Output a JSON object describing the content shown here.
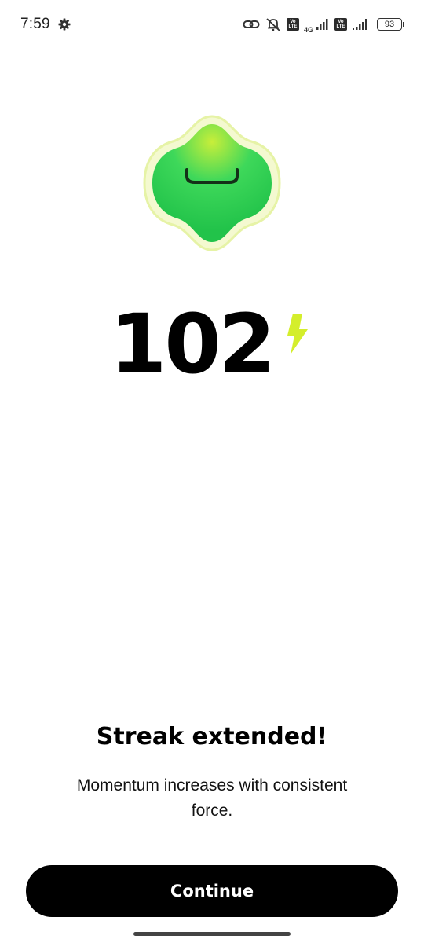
{
  "status_bar": {
    "time": "7:59",
    "network_label": "4G",
    "lte_badge_top": "Vo",
    "lte_badge_bottom": "LTE",
    "battery_level": "93",
    "icons": [
      "gear-icon",
      "link-icon",
      "mute-icon",
      "signal-icon",
      "battery-icon"
    ]
  },
  "streak": {
    "count": "102",
    "icon": "lightning-bolt-icon",
    "accent_color": "#d4ee2c"
  },
  "message": {
    "title": "Streak extended!",
    "subtitle": "Momentum increases with consistent force."
  },
  "actions": {
    "continue_label": "Continue"
  },
  "colors": {
    "mascot_green": "#2ecc55",
    "mascot_highlight": "#c8ee3a",
    "mascot_glow": "#f2f8c4",
    "button_bg": "#000000"
  }
}
